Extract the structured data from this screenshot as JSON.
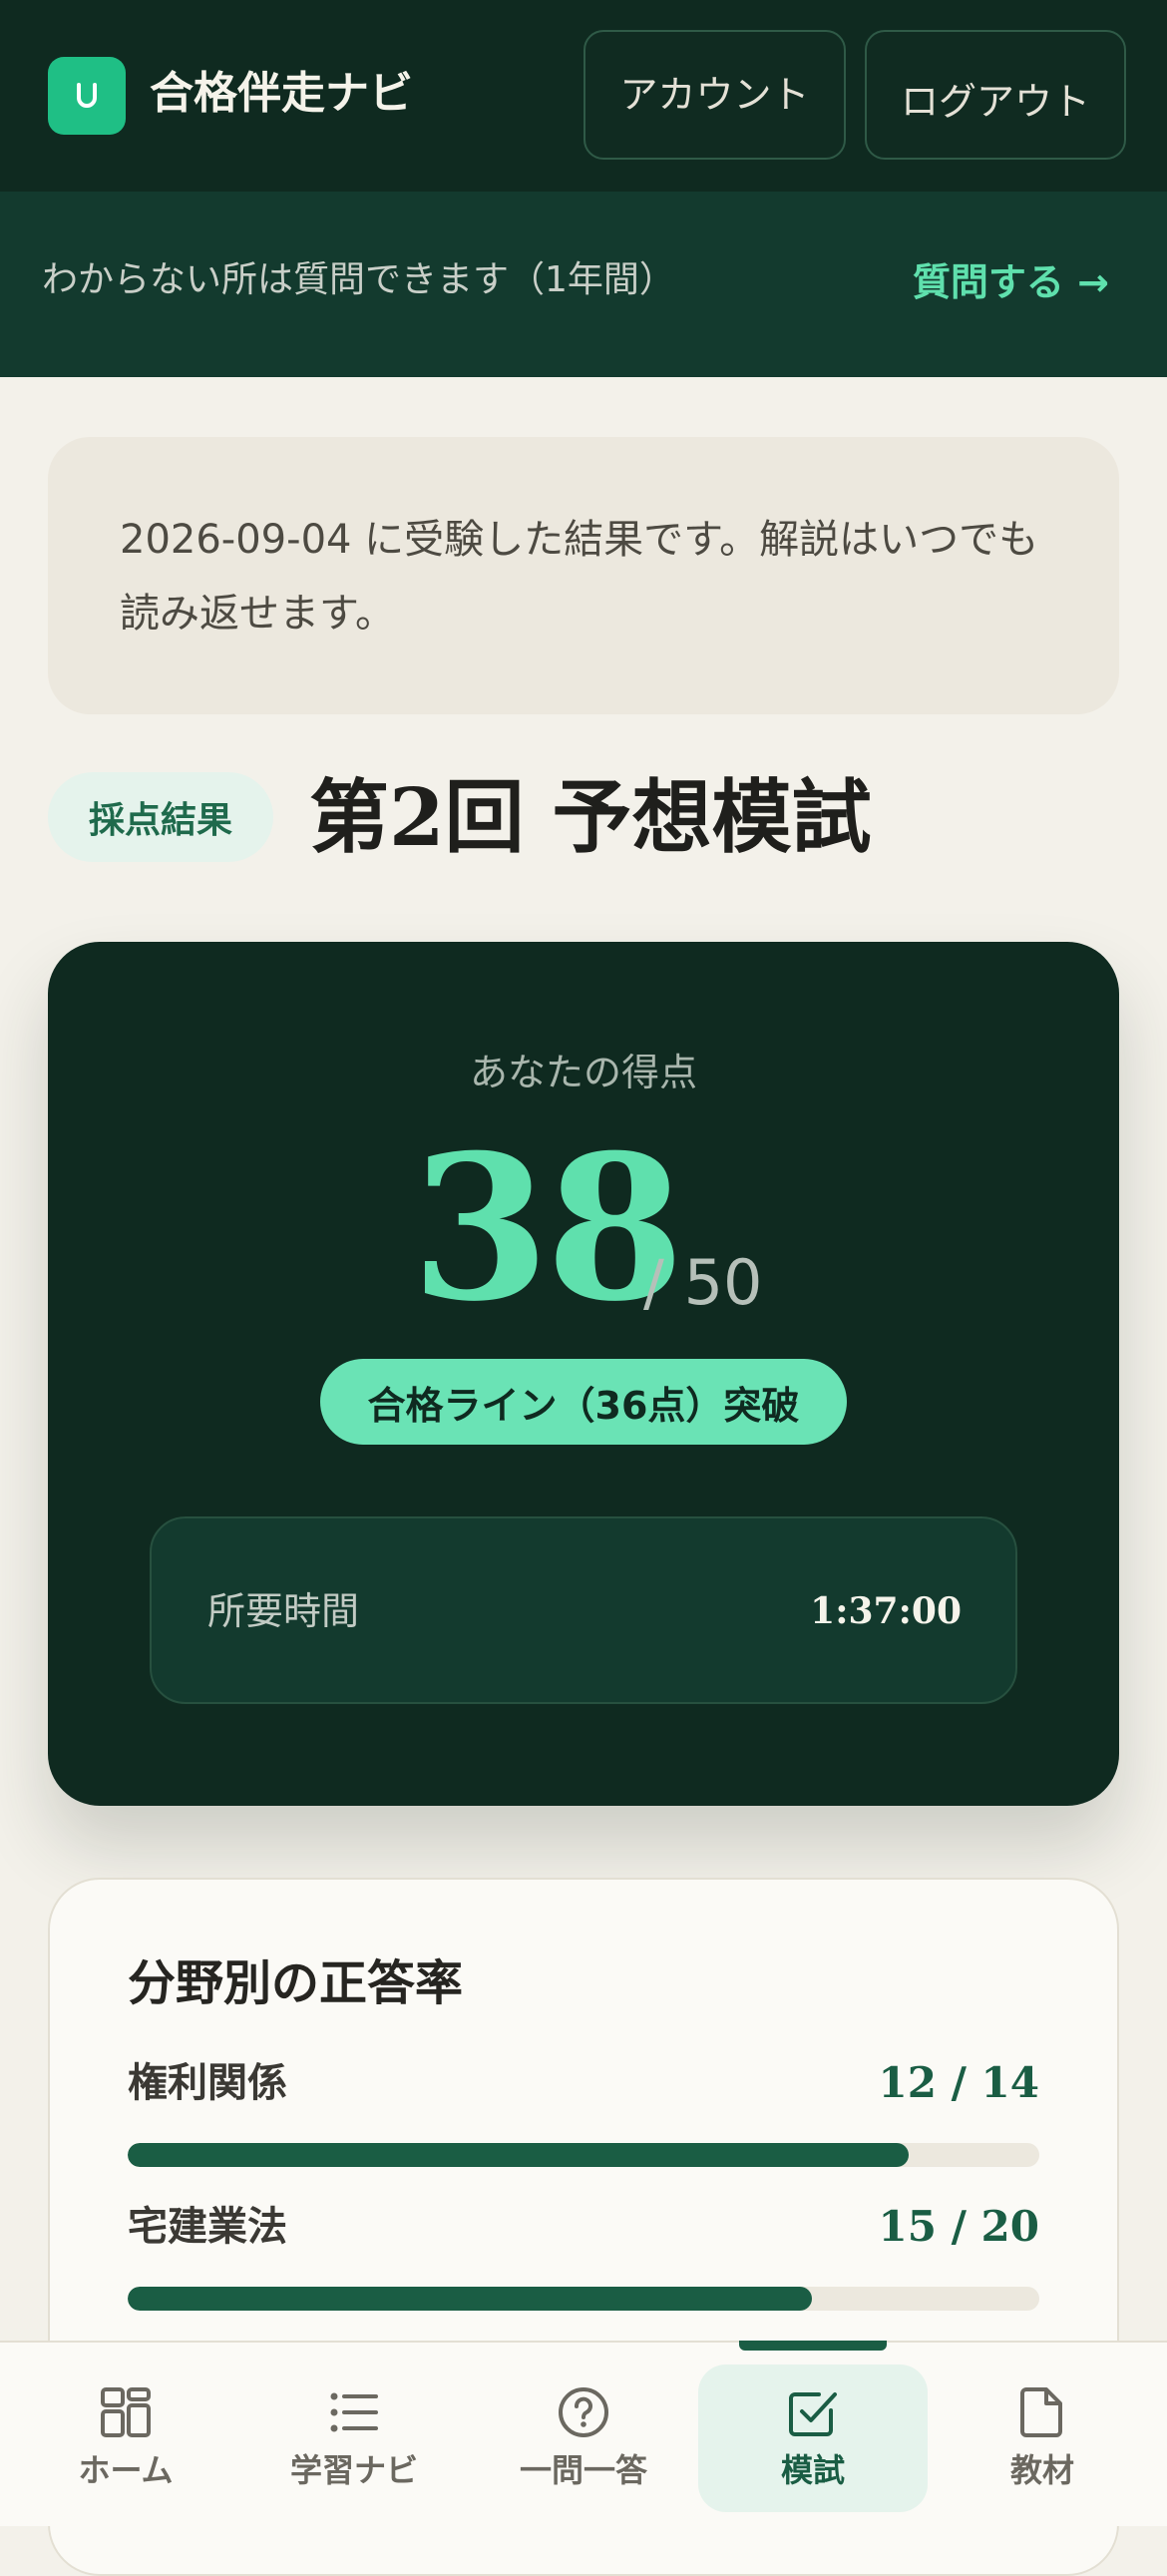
{
  "header": {
    "app_name": "合格伴走ナビ",
    "account_label": "アカウント",
    "logout_label": "ログアウト"
  },
  "question_banner": {
    "text": "わからない所は質問できます（1年間）",
    "link_label": "質問する →"
  },
  "info_text": "2026-09-04 に受験した結果です。解説はいつでも読み返せます。",
  "exam": {
    "badge": "採点結果",
    "title": "第2回 予想模試"
  },
  "score": {
    "label": "あなたの得点",
    "value": "38",
    "total": "/ 50",
    "pass_status": "合格ライン（36点）突破",
    "time_label": "所要時間",
    "time_value": "1:37:00"
  },
  "breakdown": {
    "title": "分野別の正答率",
    "categories": [
      {
        "name": "権利関係",
        "score": "12 / 14",
        "correct": 12,
        "total": 14,
        "fraction": 0.857
      },
      {
        "name": "宅建業法",
        "score": "15 / 20",
        "correct": 15,
        "total": 20,
        "fraction": 0.75
      }
    ]
  },
  "bottom_nav": {
    "items": [
      {
        "label": "ホーム",
        "icon": "grid-icon"
      },
      {
        "label": "学習ナビ",
        "icon": "list-icon"
      },
      {
        "label": "一問一答",
        "icon": "question-circle-icon"
      },
      {
        "label": "模試",
        "icon": "checkbox-icon",
        "active": true
      },
      {
        "label": "教材",
        "icon": "document-icon"
      }
    ]
  },
  "colors": {
    "brand_dark": "#0f2a20",
    "accent_green": "#5fe0ad",
    "bar_green": "#1a5d44"
  }
}
